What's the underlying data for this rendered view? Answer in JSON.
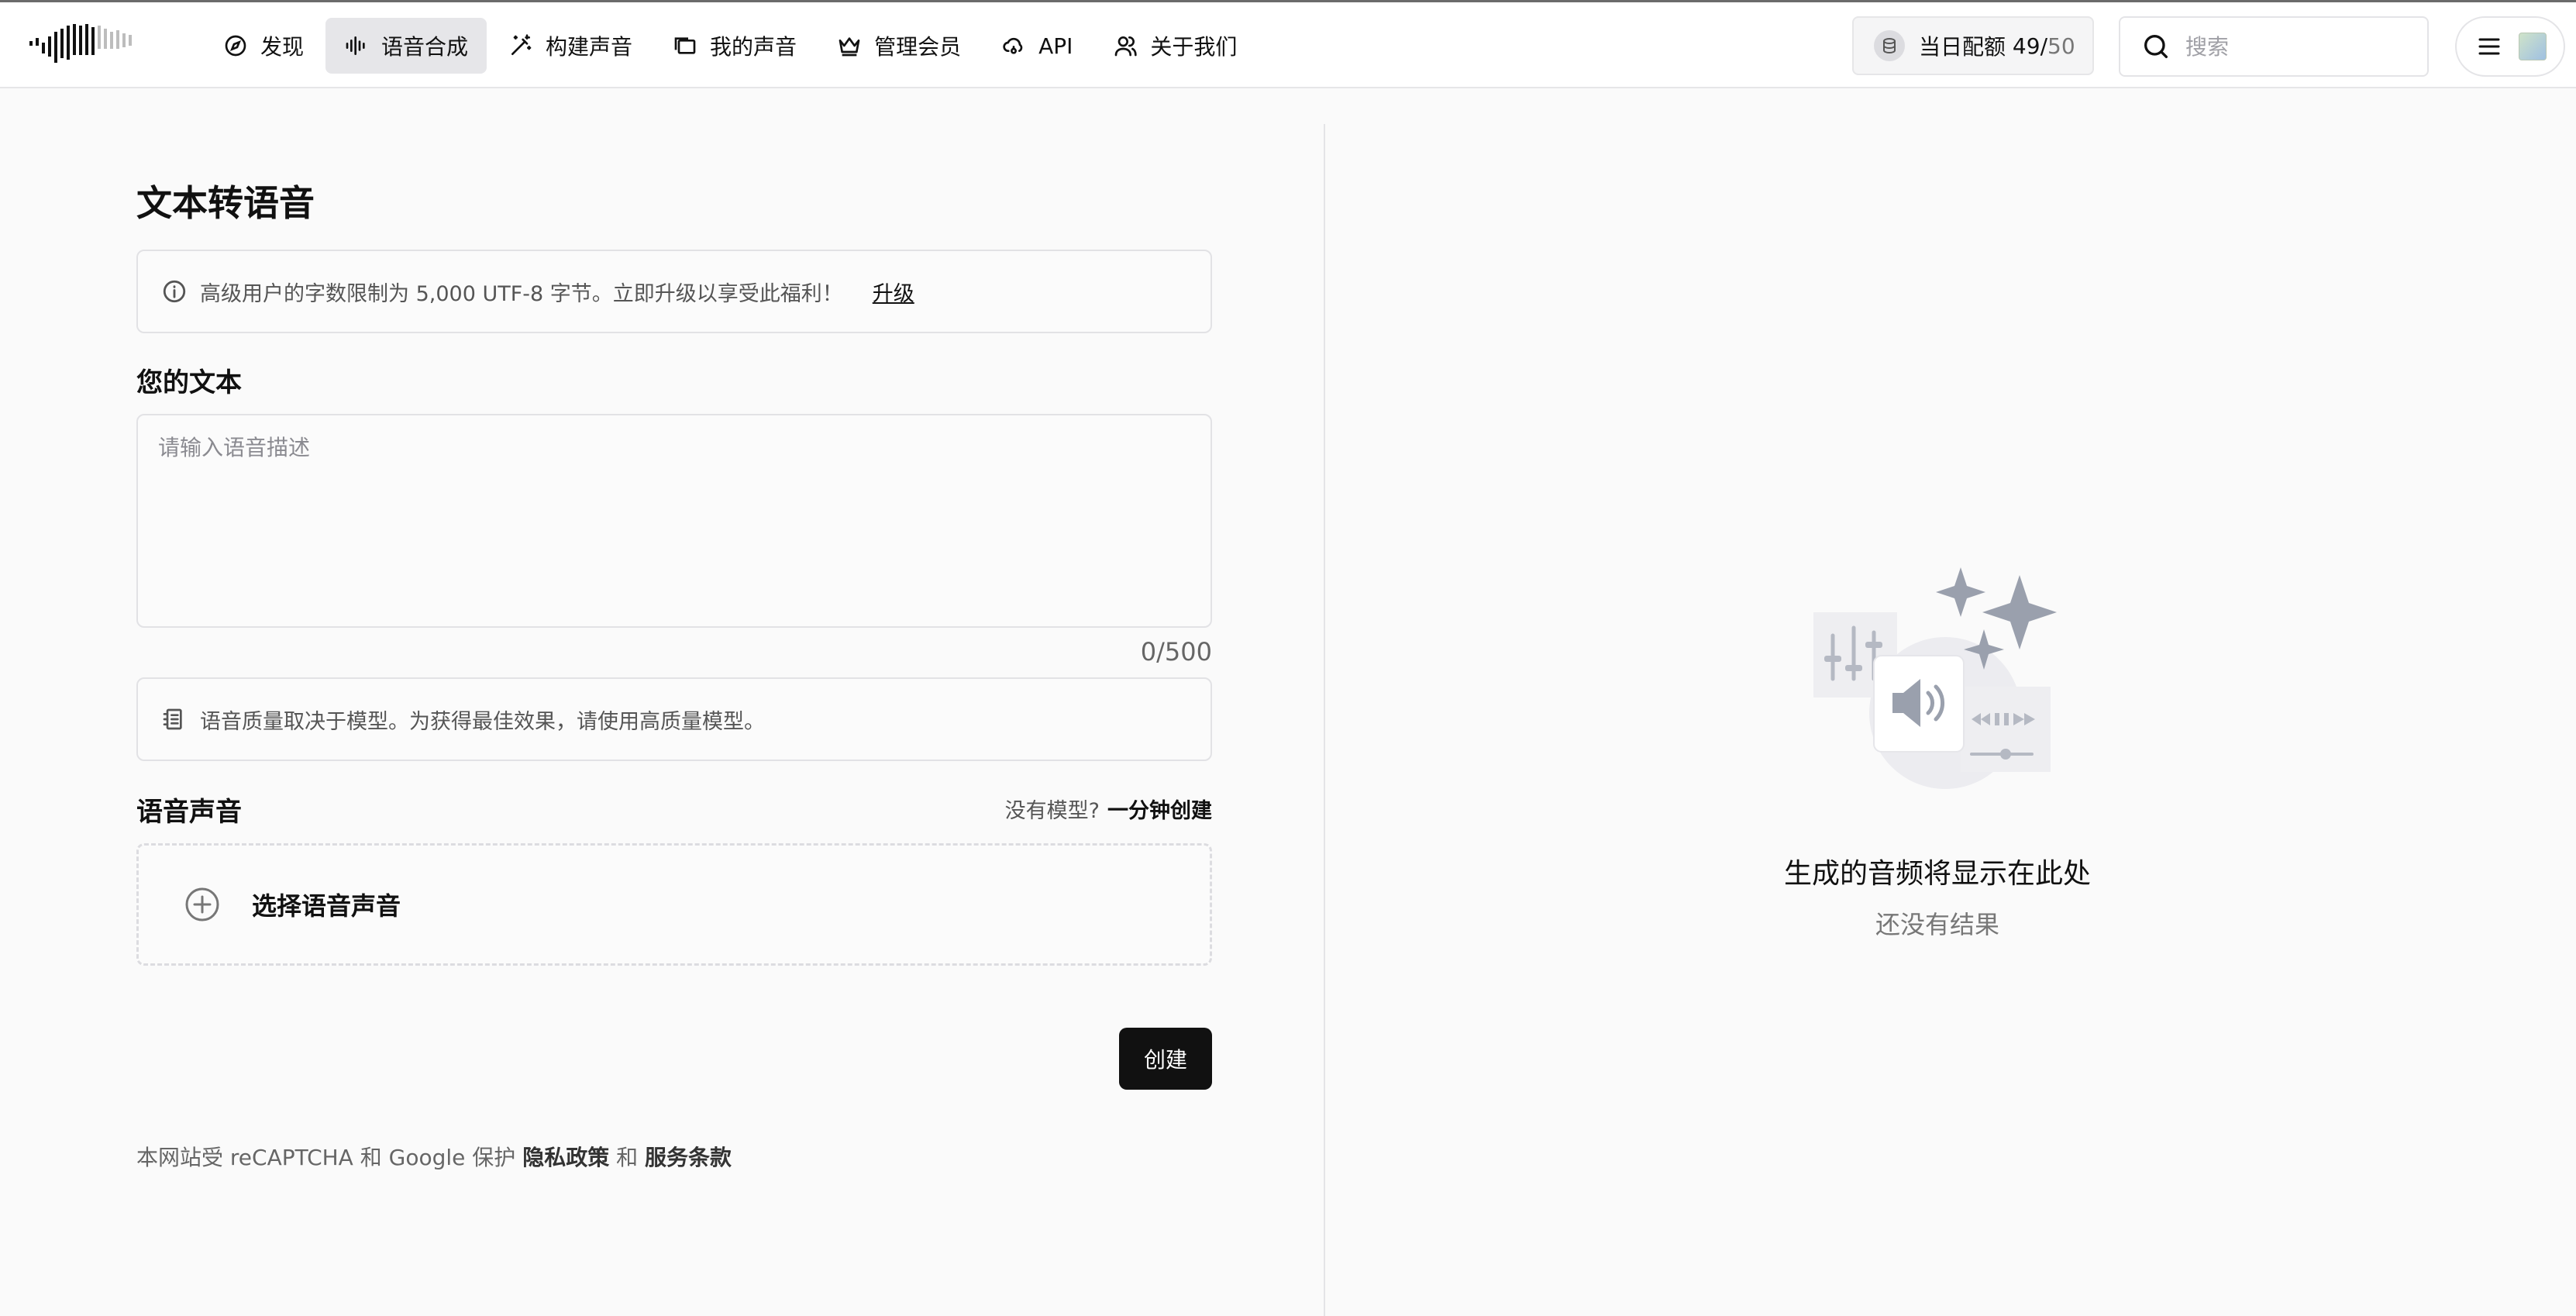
{
  "nav": {
    "items": [
      {
        "label": "发现",
        "icon": "compass-icon"
      },
      {
        "label": "语音合成",
        "icon": "waveform-icon",
        "active": true
      },
      {
        "label": "构建声音",
        "icon": "magic-wand-icon"
      },
      {
        "label": "我的声音",
        "icon": "folder-icon"
      },
      {
        "label": "管理会员",
        "icon": "crown-icon"
      },
      {
        "label": "API",
        "icon": "cloud-icon"
      },
      {
        "label": "关于我们",
        "icon": "users-icon"
      }
    ]
  },
  "quota": {
    "label": "当日配额",
    "used": "49",
    "separator": "/",
    "total": "50"
  },
  "search": {
    "placeholder": "搜索"
  },
  "main": {
    "title": "文本转语音",
    "notice": {
      "text": "高级用户的字数限制为 5,000 UTF-8 字节。立即升级以享受此福利！",
      "link": "升级"
    },
    "text_section": {
      "label": "您的文本",
      "placeholder": "请输入语音描述",
      "counter": "0/500"
    },
    "tip": "语音质量取决于模型。为获得最佳效果，请使用高质量模型。",
    "voice_section": {
      "label": "语音声音",
      "no_model": "没有模型?",
      "create_link": "一分钟创建",
      "select_label": "选择语音声音"
    },
    "create_button": "创建",
    "footer": {
      "prefix": "本网站受 reCAPTCHA 和 Google 保护",
      "privacy": "隐私政策",
      "and": "和",
      "terms": "服务条款"
    }
  },
  "result_panel": {
    "title": "生成的音频将显示在此处",
    "subtitle": "还没有结果"
  },
  "colors": {
    "accent": "#111111",
    "active_nav_bg": "#e6e6e9",
    "muted_text": "#777777",
    "illustration_gray": "#9aa0ad"
  }
}
